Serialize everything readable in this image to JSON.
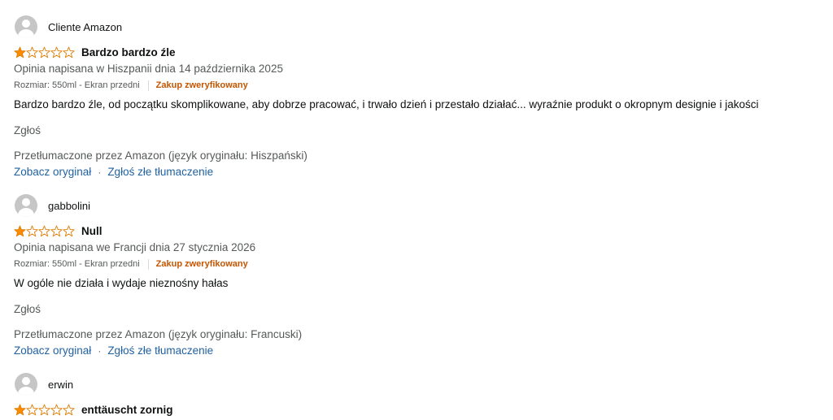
{
  "star_colors": {
    "filled": "#ff8c00",
    "empty_outline": "#e07b00"
  },
  "reviews": [
    {
      "author": "Cliente Amazon",
      "rating": 1,
      "rating_max": 5,
      "title": "Bardzo bardzo źle",
      "date": "Opinia napisana w Hiszpanii dnia 14 października 2025",
      "variant": "Rozmiar: 550ml - Ekran przedni",
      "verified": "Zakup zweryfikowany",
      "body": "Bardzo bardzo źle, od początku skomplikowane, aby dobrze pracować, i trwało dzień i przestało działać... wyraźnie produkt o okropnym designie i jakości",
      "report": "Zgłoś",
      "translated": "Przetłumaczone przez Amazon (język oryginału: Hiszpański)",
      "see_original": "Zobacz oryginał",
      "separator": "·",
      "report_translation": "Zgłoś złe tłumaczenie"
    },
    {
      "author": "gabbolini",
      "rating": 1,
      "rating_max": 5,
      "title": "Null",
      "date": "Opinia napisana we Francji dnia 27 stycznia 2026",
      "variant": "Rozmiar: 550ml - Ekran przedni",
      "verified": "Zakup zweryfikowany",
      "body": "W ogóle nie działa i wydaje nieznośny hałas",
      "report": "Zgłoś",
      "translated": "Przetłumaczone przez Amazon (język oryginału: Francuski)",
      "see_original": "Zobacz oryginał",
      "separator": "·",
      "report_translation": "Zgłoś złe tłumaczenie"
    },
    {
      "author": "erwin",
      "rating": 1,
      "rating_max": 5,
      "title": "enttäuscht zornig"
    }
  ]
}
